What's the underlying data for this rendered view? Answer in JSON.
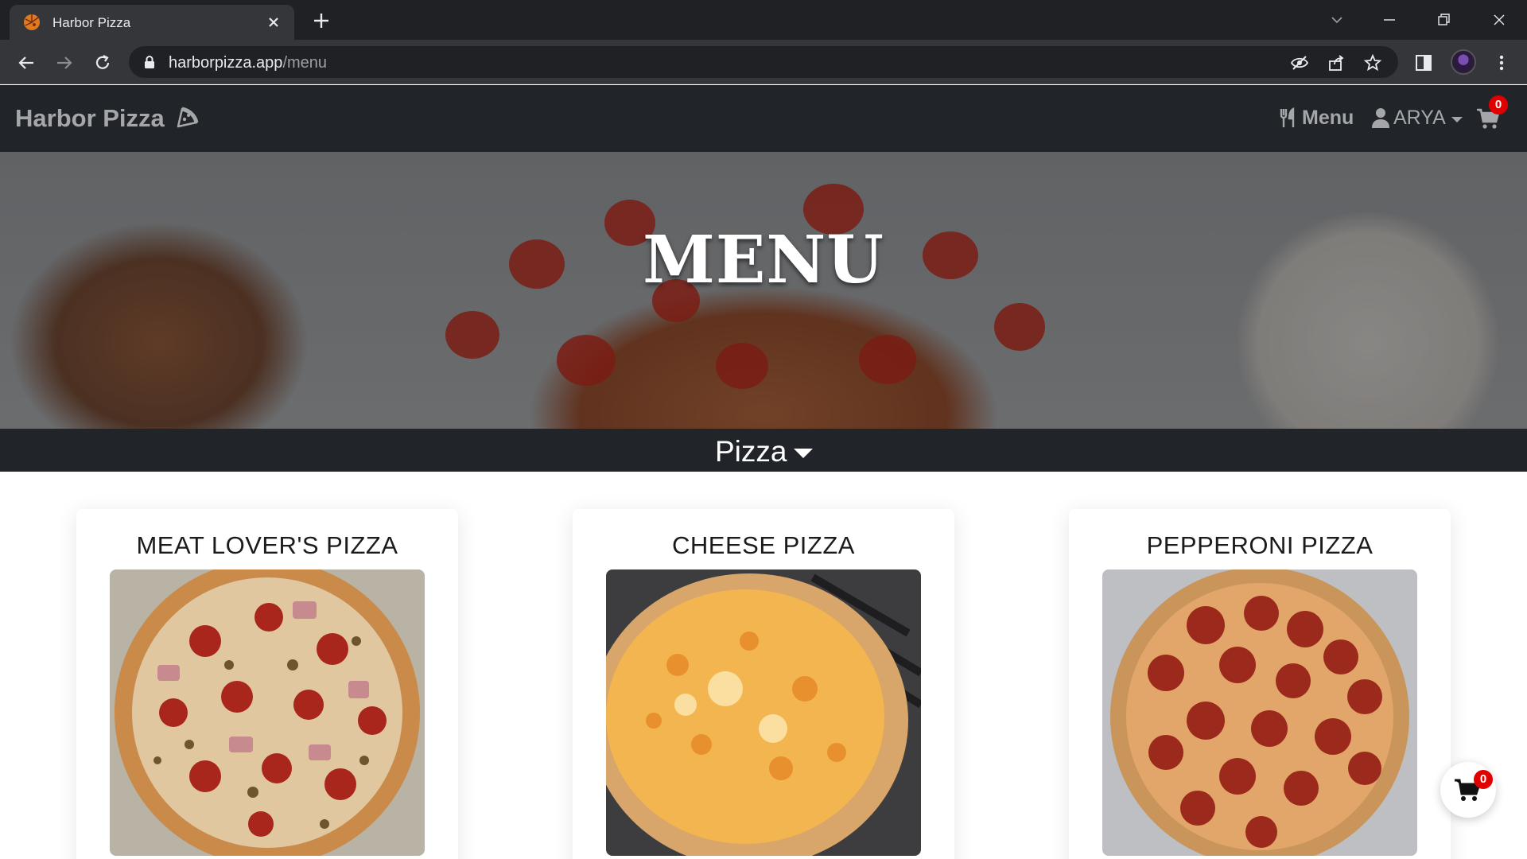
{
  "browser": {
    "tab_title": "Harbor Pizza",
    "url_domain": "harborpizza.app",
    "url_path": "/menu"
  },
  "navbar": {
    "brand": "Harbor Pizza",
    "menu_label": "Menu",
    "user_label": "ARYA",
    "cart_count": "0"
  },
  "hero": {
    "title": "MENU"
  },
  "category": {
    "label": "Pizza"
  },
  "cards": [
    {
      "title": "MEAT LOVER'S PIZZA"
    },
    {
      "title": "CHEESE PIZZA"
    },
    {
      "title": "PEPPERONI PIZZA"
    }
  ],
  "floating_cart": {
    "count": "0"
  },
  "colors": {
    "navbar_bg": "#212529",
    "badge": "#e00000",
    "chrome_bg": "#202124"
  }
}
